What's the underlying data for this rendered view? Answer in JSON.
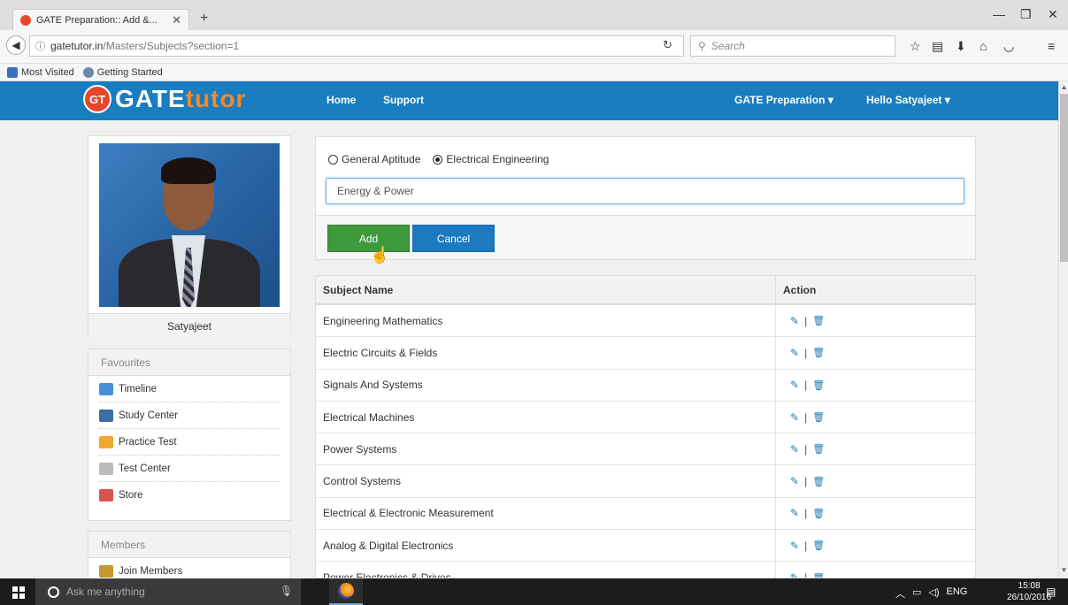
{
  "browser": {
    "tab_title": "GATE Preparation:: Add &...",
    "tab_close": "✕",
    "new_tab": "+",
    "url_domain": "gatetutor.in",
    "url_path": "/Masters/Subjects?section=1",
    "search_placeholder": "Search",
    "bookmarks": [
      "Most Visited",
      "Getting Started"
    ]
  },
  "site": {
    "logo_badge": "GT",
    "logo_gate": "GATE",
    "logo_tutor": "tutor",
    "nav_home": "Home",
    "nav_support": "Support",
    "nav_gate_prep": "GATE Preparation ▾",
    "nav_user": "Hello Satyajeet ▾"
  },
  "profile": {
    "name": "Satyajeet"
  },
  "favourites": {
    "title": "Favourites",
    "items": [
      {
        "label": "Timeline",
        "icon": "calendar-icon",
        "color": "#4a90d9"
      },
      {
        "label": "Study Center",
        "icon": "books-icon",
        "color": "#3a6ea5"
      },
      {
        "label": "Practice Test",
        "icon": "clipboard-icon",
        "color": "#f0a830"
      },
      {
        "label": "Test Center",
        "icon": "pen-icon",
        "color": "#bbbbbb"
      },
      {
        "label": "Store",
        "icon": "store-icon",
        "color": "#d9534f"
      }
    ]
  },
  "members": {
    "title": "Members",
    "items": [
      {
        "label": "Join Members",
        "icon": "members-icon",
        "color": "#c8962e"
      }
    ]
  },
  "form": {
    "radio_general": "General Aptitude",
    "radio_electrical": "Electrical Engineering",
    "selected": "Electrical Engineering",
    "subject_value": "Energy & Power",
    "add_label": "Add",
    "cancel_label": "Cancel"
  },
  "table": {
    "headers": [
      "Subject Name",
      "Action"
    ],
    "rows": [
      "Engineering Mathematics",
      "Electric Circuits & Fields",
      "Signals And Systems",
      "Electrical Machines",
      "Power Systems",
      "Control Systems",
      "Electrical & Electronic Measurement",
      "Analog & Digital Electronics",
      "Power Electronics & Drives"
    ]
  },
  "taskbar": {
    "search_text": "Ask me anything",
    "lang": "ENG",
    "time": "15:08",
    "date": "26/10/2016"
  },
  "colors": {
    "header_blue": "#1a7dbf",
    "add_green": "#3d9a3c",
    "cancel_blue": "#1b7ac0",
    "logo_orange": "#f08a2c"
  }
}
